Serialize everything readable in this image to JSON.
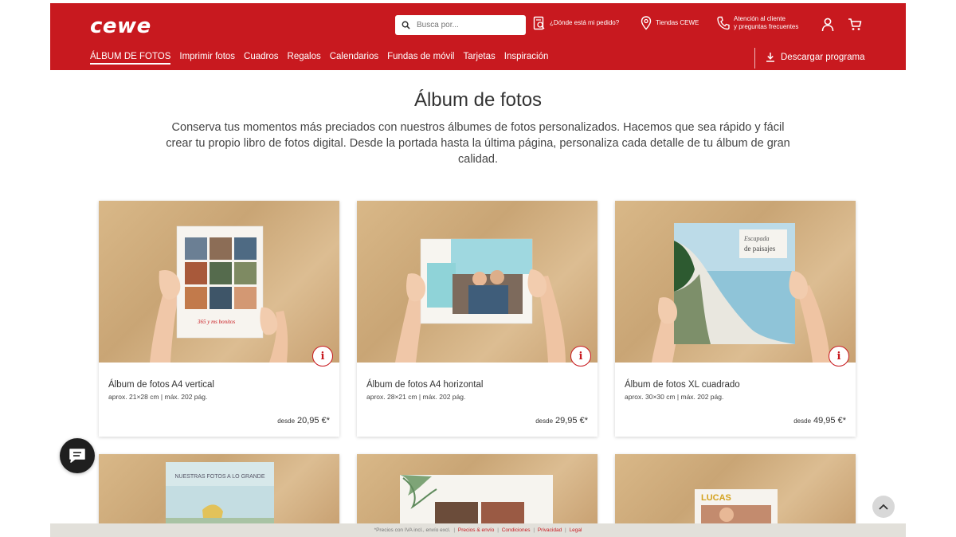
{
  "header": {
    "brand": "cewe",
    "search_placeholder": "Busca por...",
    "order_link": "¿Dónde está mi pedido?",
    "stores_link": "Tiendas CEWE",
    "support_line1": "Atención al cliente",
    "support_line2": "y preguntas frecuentes",
    "nav": [
      "ÁLBUM DE FOTOS",
      "Imprimir fotos",
      "Cuadros",
      "Regalos",
      "Calendarios",
      "Fundas de móvil",
      "Tarjetas",
      "Inspiración"
    ],
    "download": "Descargar programa"
  },
  "intro": {
    "title": "Álbum de fotos",
    "text": "Conserva tus momentos más preciados con nuestros álbumes de fotos personalizados. Hacemos que sea rápido y fácil crear tu propio libro de fotos digital. Desde la portada hasta la última página, personaliza cada detalle de tu álbum de gran calidad."
  },
  "products": [
    {
      "name": "Álbum de fotos A4 vertical",
      "spec": "aprox. 21×28 cm | máx. 202 pág.",
      "from": "desde",
      "price": "20,95 €*",
      "cover_text": "365 y ms bonitos"
    },
    {
      "name": "Álbum de fotos A4 horizontal",
      "spec": "aprox. 28×21 cm | máx. 202 pág.",
      "from": "desde",
      "price": "29,95 €*"
    },
    {
      "name": "Álbum de fotos XL cuadrado",
      "spec": "aprox. 30×30 cm | máx. 202 pág.",
      "from": "desde",
      "price": "49,95 €*",
      "cover_line1": "Escapada",
      "cover_line2": "de paisajes"
    }
  ],
  "row2": {
    "cover1": "NUESTRAS FOTOS A LO GRANDE",
    "cover3": "LUCAS"
  },
  "info_symbol": "i",
  "footer": {
    "note": "*Precios con IVA incl., envío excl.",
    "links": [
      "Precios & envío",
      "Condiciones",
      "Privacidad",
      "Legal"
    ]
  },
  "colors": {
    "brand_red": "#c8191f"
  }
}
